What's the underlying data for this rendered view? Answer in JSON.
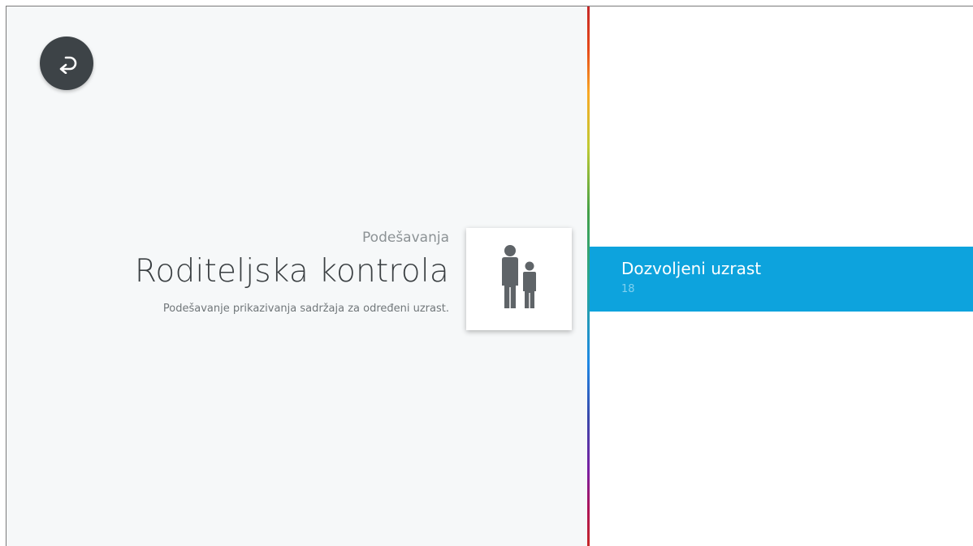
{
  "header": {
    "back_icon": "back-arrow-icon"
  },
  "main": {
    "breadcrumb": "Podešavanja",
    "title": "Roditeljska kontrola",
    "description": "Podešavanje prikazivanja sadržaja za određeni uzrast.",
    "card_icon": "family-icon"
  },
  "menu": {
    "items": [
      {
        "label": "Dozvoljeni uzrast",
        "value": "18",
        "selected": true
      }
    ]
  },
  "colors": {
    "accent": "#0da3dd",
    "background": "#f6f8f9",
    "back_button": "#3d4347",
    "icon": "#5f6468"
  }
}
